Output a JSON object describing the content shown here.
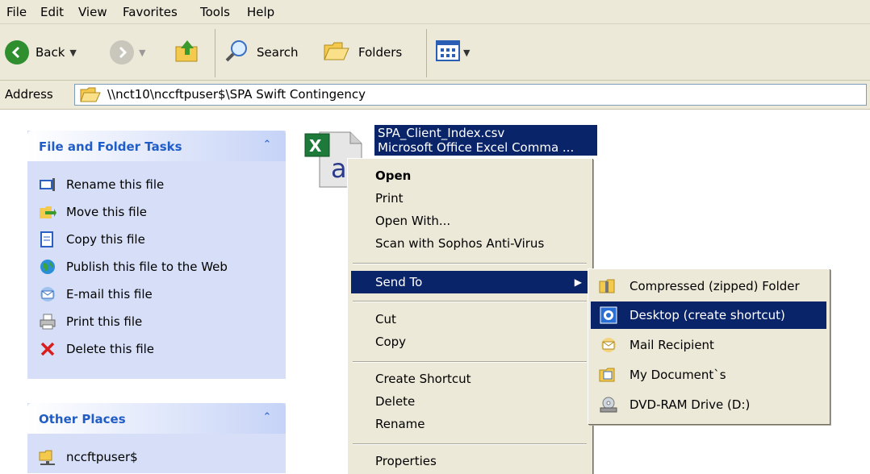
{
  "menubar": {
    "items": [
      "File",
      "Edit",
      "View",
      "Favorites",
      "Tools",
      "Help"
    ]
  },
  "toolbar": {
    "back_label": "Back",
    "search_label": "Search",
    "folders_label": "Folders"
  },
  "address": {
    "label": "Address",
    "value": "\\\\nct10\\nccftpuser$\\SPA Swift Contingency"
  },
  "file_tasks": {
    "title": "File and Folder Tasks",
    "items": [
      "Rename this file",
      "Move this file",
      "Copy this file",
      "Publish this file to the Web",
      "E-mail this file",
      "Print this file",
      "Delete this file"
    ]
  },
  "other_places": {
    "title": "Other Places",
    "items": [
      "nccftpuser$"
    ]
  },
  "file": {
    "name": "SPA_Client_Index.csv",
    "type": "Microsoft Office Excel Comma ..."
  },
  "context_menu": {
    "open": "Open",
    "print": "Print",
    "open_with": "Open With...",
    "scan": "Scan with Sophos Anti-Virus",
    "send_to": "Send To",
    "cut": "Cut",
    "copy": "Copy",
    "create_shortcut": "Create Shortcut",
    "delete": "Delete",
    "rename": "Rename",
    "properties": "Properties"
  },
  "send_to_menu": {
    "items": [
      "Compressed (zipped) Folder",
      "Desktop (create shortcut)",
      "Mail Recipient",
      "My Document`s",
      "DVD-RAM Drive (D:)"
    ]
  },
  "colors": {
    "selection": "#0a246a",
    "chrome": "#ece9d8",
    "pane": "#d6dff7",
    "pane_title": "#215dc6"
  }
}
